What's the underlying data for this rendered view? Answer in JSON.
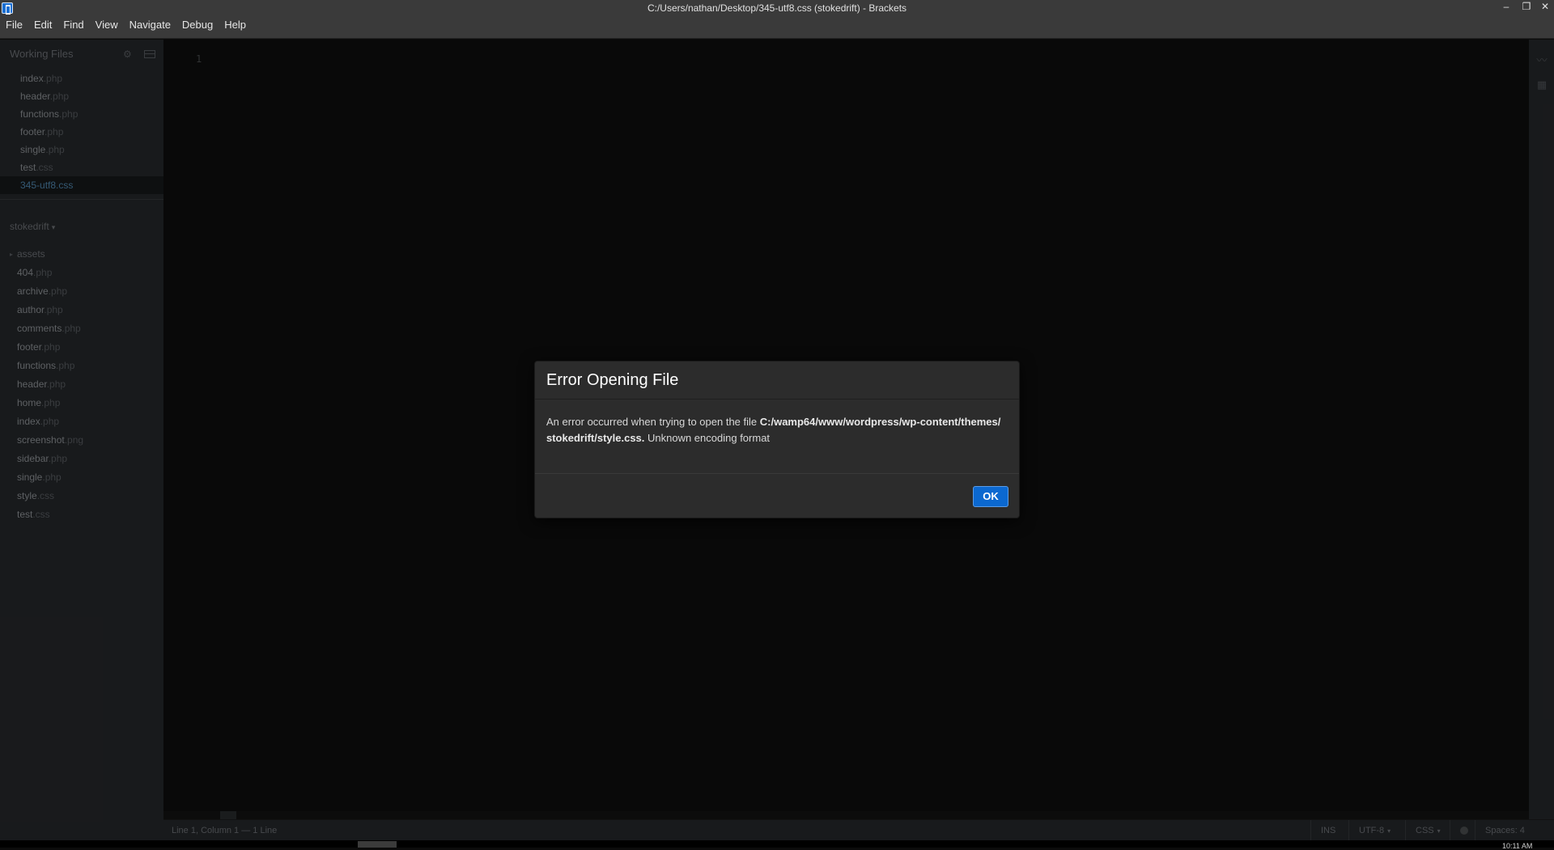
{
  "window": {
    "title": "C:/Users/nathan/Desktop/345-utf8.css (stokedrift) - Brackets",
    "minimize": "–",
    "maximize": "❐",
    "close": "✕"
  },
  "menu": {
    "items": [
      "File",
      "Edit",
      "Find",
      "View",
      "Navigate",
      "Debug",
      "Help"
    ]
  },
  "working_files": {
    "header": "Working Files",
    "items": [
      {
        "base": "index",
        "ext": ".php"
      },
      {
        "base": "header",
        "ext": ".php"
      },
      {
        "base": "functions",
        "ext": ".php"
      },
      {
        "base": "footer",
        "ext": ".php"
      },
      {
        "base": "single",
        "ext": ".php"
      },
      {
        "base": "test",
        "ext": ".css"
      },
      {
        "base": "345-utf8",
        "ext": ".css"
      }
    ],
    "active_index": 6
  },
  "project": {
    "name": "stokedrift",
    "caret": "▾",
    "folder": {
      "name": "assets",
      "caret": "▸"
    },
    "files": [
      {
        "base": "404",
        "ext": ".php"
      },
      {
        "base": "archive",
        "ext": ".php"
      },
      {
        "base": "author",
        "ext": ".php"
      },
      {
        "base": "comments",
        "ext": ".php"
      },
      {
        "base": "footer",
        "ext": ".php"
      },
      {
        "base": "functions",
        "ext": ".php"
      },
      {
        "base": "header",
        "ext": ".php"
      },
      {
        "base": "home",
        "ext": ".php"
      },
      {
        "base": "index",
        "ext": ".php"
      },
      {
        "base": "screenshot",
        "ext": ".png"
      },
      {
        "base": "sidebar",
        "ext": ".php"
      },
      {
        "base": "single",
        "ext": ".php"
      },
      {
        "base": "style",
        "ext": ".css"
      },
      {
        "base": "test",
        "ext": ".css"
      }
    ]
  },
  "editor": {
    "line_number": "1"
  },
  "statusbar": {
    "position": "Line 1, Column 1 — 1 Line",
    "mode": "INS",
    "encoding": "UTF-8",
    "language": "CSS",
    "spaces": "Spaces: 4",
    "caret": "▾"
  },
  "taskbar": {
    "clock": "10:11 AM"
  },
  "dialog": {
    "title": "Error Opening File",
    "message_prefix": "An error occurred when trying to open the file ",
    "path_line1": "C:/wamp64/www/wordpress/wp-content/themes/",
    "path_line2": "stokedrift/style.css.",
    "message_suffix": " Unknown encoding format",
    "ok_label": "OK"
  },
  "icons": {
    "gear": "⚙",
    "live_preview": "〰",
    "extension_manager": "▦"
  }
}
